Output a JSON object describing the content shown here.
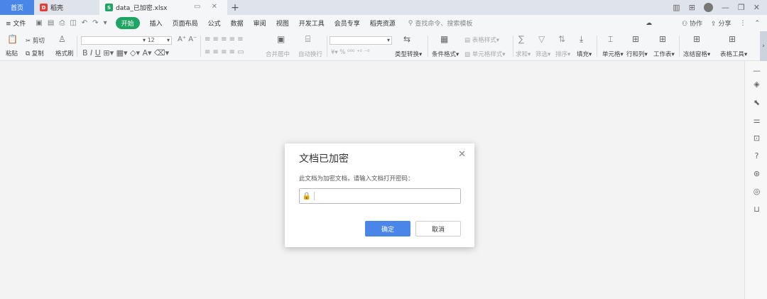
{
  "tabs": {
    "home": "首页",
    "daoke": "稻壳",
    "file": "data_已加密.xlsx",
    "add": "+"
  },
  "menu": {
    "file": "文件",
    "start": "开始",
    "items": [
      "插入",
      "页面布局",
      "公式",
      "数据",
      "审阅",
      "视图",
      "开发工具",
      "会员专享",
      "稻壳资源"
    ],
    "search_placeholder": "查找命令、搜索模板",
    "collab": "协作",
    "share": "分享"
  },
  "ribbon": {
    "paste": "粘贴",
    "cut": "剪切",
    "copy": "复制",
    "format_painter": "格式刷",
    "font_size": "12",
    "merge_center": "合并居中",
    "auto_wrap": "自动换行",
    "type_convert": "类型转换",
    "cond_format": "条件格式",
    "table_style": "表格样式",
    "cell_style": "单元格样式",
    "sum": "求和",
    "filter": "筛选",
    "sort": "排序",
    "fill": "填充",
    "cell": "单元格",
    "row_col": "行和列",
    "worksheet": "工作表",
    "freeze": "冻结窗格",
    "table_tools": "表格工具"
  },
  "dialog": {
    "title": "文档已加密",
    "message": "此文档为加密文档，请输入文档打开密码：",
    "password_value": "",
    "ok": "确定",
    "cancel": "取消"
  },
  "colors": {
    "accent": "#4a86e8",
    "start_green": "#1fa463"
  }
}
